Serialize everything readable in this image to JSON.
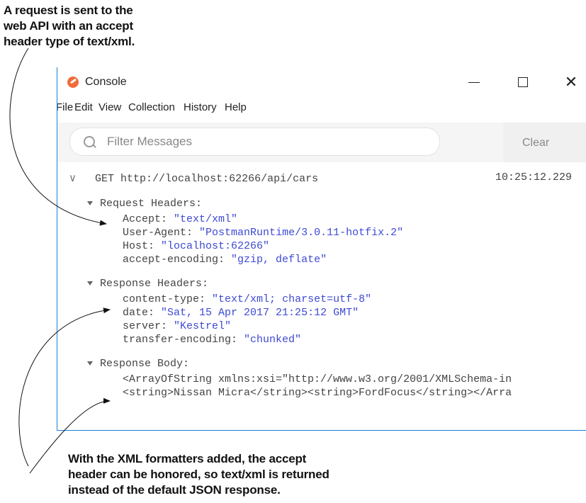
{
  "annotations": {
    "top": [
      "A request is sent to the",
      "web API with an accept",
      "header type of text/xml."
    ],
    "bottom": [
      "With the XML formatters added, the accept",
      "header can be honored, so text/xml is returned",
      "instead of the default JSON response."
    ]
  },
  "window": {
    "title": "Console",
    "controls": {
      "close": "✕"
    }
  },
  "menu": [
    "File",
    "Edit",
    "View",
    "Collection",
    "History",
    "Help"
  ],
  "toolbar": {
    "search_placeholder": "Filter Messages",
    "clear_label": "Clear"
  },
  "request": {
    "method": "GET",
    "url": "http://localhost:62266/api/cars",
    "time": "10:25:12.229",
    "request_headers_label": "Request Headers:",
    "request_headers": [
      {
        "key": "Accept:",
        "value": "\"text/xml\""
      },
      {
        "key": "User-Agent:",
        "value": "\"PostmanRuntime/3.0.11-hotfix.2\""
      },
      {
        "key": "Host:",
        "value": "\"localhost:62266\""
      },
      {
        "key": "accept-encoding:",
        "value": "\"gzip, deflate\""
      }
    ],
    "response_headers_label": "Response Headers:",
    "response_headers": [
      {
        "key": "content-type:",
        "value": "\"text/xml; charset=utf-8\""
      },
      {
        "key": "date:",
        "value": "\"Sat, 15 Apr 2017 21:25:12 GMT\""
      },
      {
        "key": "server:",
        "value": "\"Kestrel\""
      },
      {
        "key": "transfer-encoding:",
        "value": "\"chunked\""
      }
    ],
    "response_body_label": "Response Body:",
    "response_body": [
      "<ArrayOfString xmlns:xsi=\"http://www.w3.org/2001/XMLSchema-in",
      "<string>Nissan Micra</string><string>FordFocus</string></Arra"
    ]
  }
}
